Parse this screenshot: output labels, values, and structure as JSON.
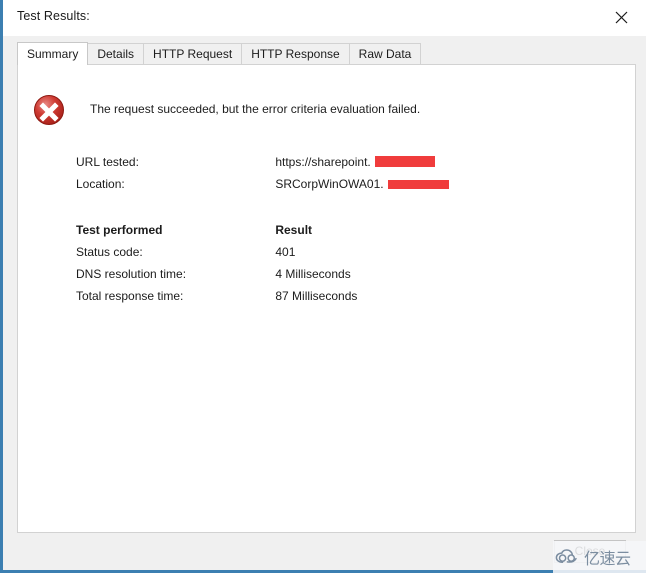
{
  "window": {
    "title": "Test Results:",
    "close_icon": "close-icon",
    "accent_border_color": "#3c7fb1"
  },
  "tabs": [
    {
      "label": "Summary",
      "selected": true
    },
    {
      "label": "Details",
      "selected": false
    },
    {
      "label": "HTTP Request",
      "selected": false
    },
    {
      "label": "HTTP Response",
      "selected": false
    },
    {
      "label": "Raw Data",
      "selected": false
    }
  ],
  "summary": {
    "status_icon": "error-icon",
    "message": "The request succeeded, but the error criteria evaluation failed.",
    "redaction_color": "#f03c3c",
    "url_table": {
      "rows": [
        {
          "label": "URL tested:",
          "value": "https://sharepoint.",
          "redacted": true
        },
        {
          "label": "Location:",
          "value": "SRCorpWinOWA01.",
          "redacted": true
        }
      ]
    },
    "performance_table": {
      "header": {
        "label": "Test performed",
        "value": "Result"
      },
      "rows": [
        {
          "label": "Status code:",
          "value": "401"
        },
        {
          "label": "DNS resolution time:",
          "value": "4 Milliseconds"
        },
        {
          "label": "Total response time:",
          "value": "87 Milliseconds"
        }
      ]
    }
  },
  "footer": {
    "close_label": "Close"
  },
  "watermark": {
    "text": "亿速云",
    "icon": "cloud-icon",
    "color": "#7b8da0"
  }
}
